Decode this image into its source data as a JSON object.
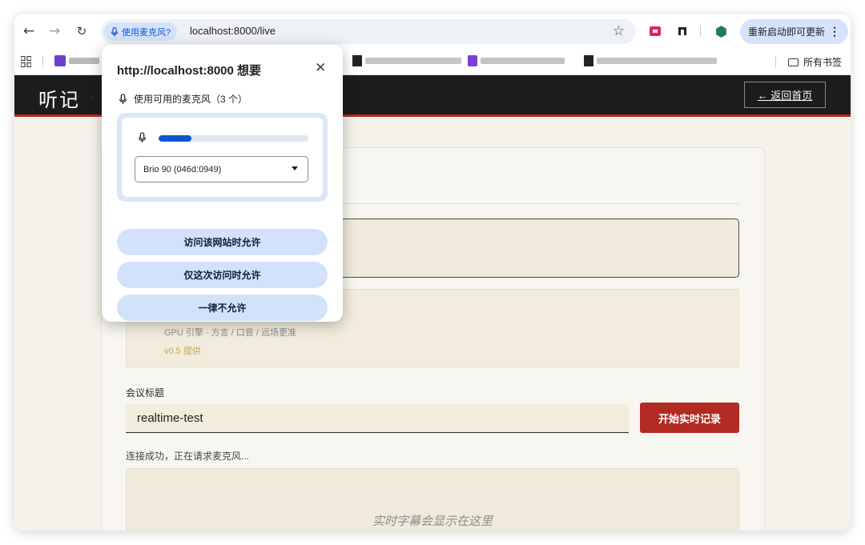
{
  "browser": {
    "mic_chip_label": "使用麦克风?",
    "url": "localhost:8000/live",
    "update_label": "重新启动即可更新",
    "all_bookmarks": "所有书签"
  },
  "site": {
    "logo": "听记",
    "back_button": "← 返回首页"
  },
  "main": {
    "engine_note": "GPU 引擎 · 方言 / 口音 / 远场更准",
    "engine_version": "v0.5 提供",
    "title_label": "会议标题",
    "title_value": "realtime-test",
    "start_button": "开始实时记录",
    "status_text": "连接成功，正在请求麦克风...",
    "transcript_placeholder": "实时字幕会显示在这里"
  },
  "permission_popup": {
    "title": "http://localhost:8000 想要",
    "subtitle": "使用可用的麦克风（3 个）",
    "mic_level": 0.22,
    "selected_device": "Brio 90 (046d:0949)",
    "buttons": [
      "访问该网站时允许",
      "仅这次访问时允许",
      "一律不允许"
    ]
  },
  "colors": {
    "accent_red": "#b32a23",
    "chrome_blue": "#0b57d0",
    "header_dark": "#1c1c1c"
  },
  "icons": [
    "back-arrow-icon",
    "forward-arrow-icon",
    "reload-icon",
    "mic-icon",
    "star-icon",
    "apps-grid-icon",
    "folder-icon",
    "close-icon",
    "chevron-down-icon",
    "menu-dots-icon"
  ]
}
